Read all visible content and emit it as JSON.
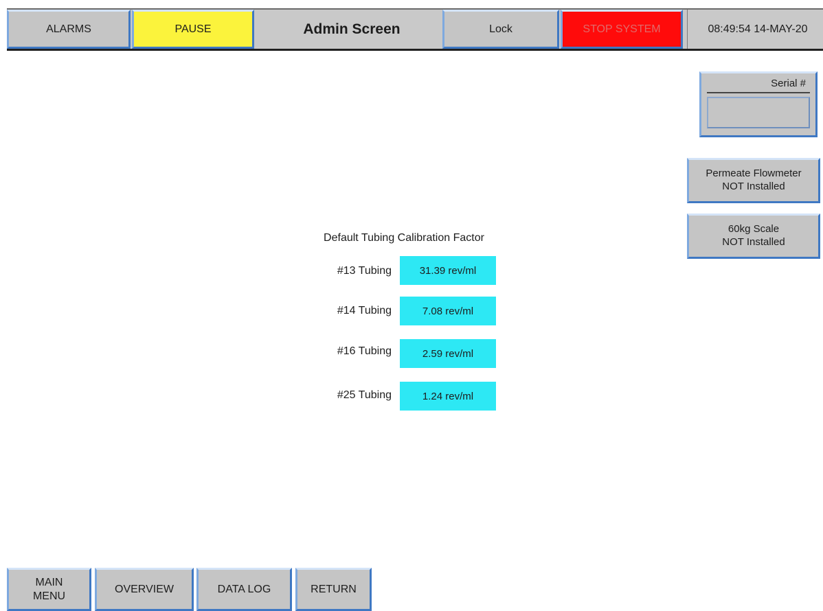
{
  "header": {
    "alarms_label": "ALARMS",
    "pause_label": "PAUSE",
    "title": "Admin Screen",
    "lock_label": "Lock",
    "stop_label": "STOP SYSTEM",
    "datetime": "08:49:54 14-MAY-20"
  },
  "serial": {
    "label": "Serial #",
    "value": ""
  },
  "side_buttons": {
    "permeate_flowmeter": "Permeate Flowmeter\nNOT Installed",
    "scale_60kg": "60kg Scale\nNOT Installed"
  },
  "calibration": {
    "title": "Default Tubing Calibration Factor",
    "rows": [
      {
        "label": "#13 Tubing",
        "value": "31.39 rev/ml"
      },
      {
        "label": "#14 Tubing",
        "value": "7.08 rev/ml"
      },
      {
        "label": "#16 Tubing",
        "value": "2.59 rev/ml"
      },
      {
        "label": "#25 Tubing",
        "value": "1.24 rev/ml"
      }
    ]
  },
  "footer": {
    "main_menu_label": "MAIN\nMENU",
    "overview_label": "OVERVIEW",
    "data_log_label": "DATA LOG",
    "return_label": "RETURN"
  },
  "colors": {
    "pause": "#fbf33c",
    "stop": "#ff0b0b",
    "value_fill": "#2de8f4",
    "button_gray": "#c5c5c5",
    "button_border_blue": "#3f78c3"
  }
}
